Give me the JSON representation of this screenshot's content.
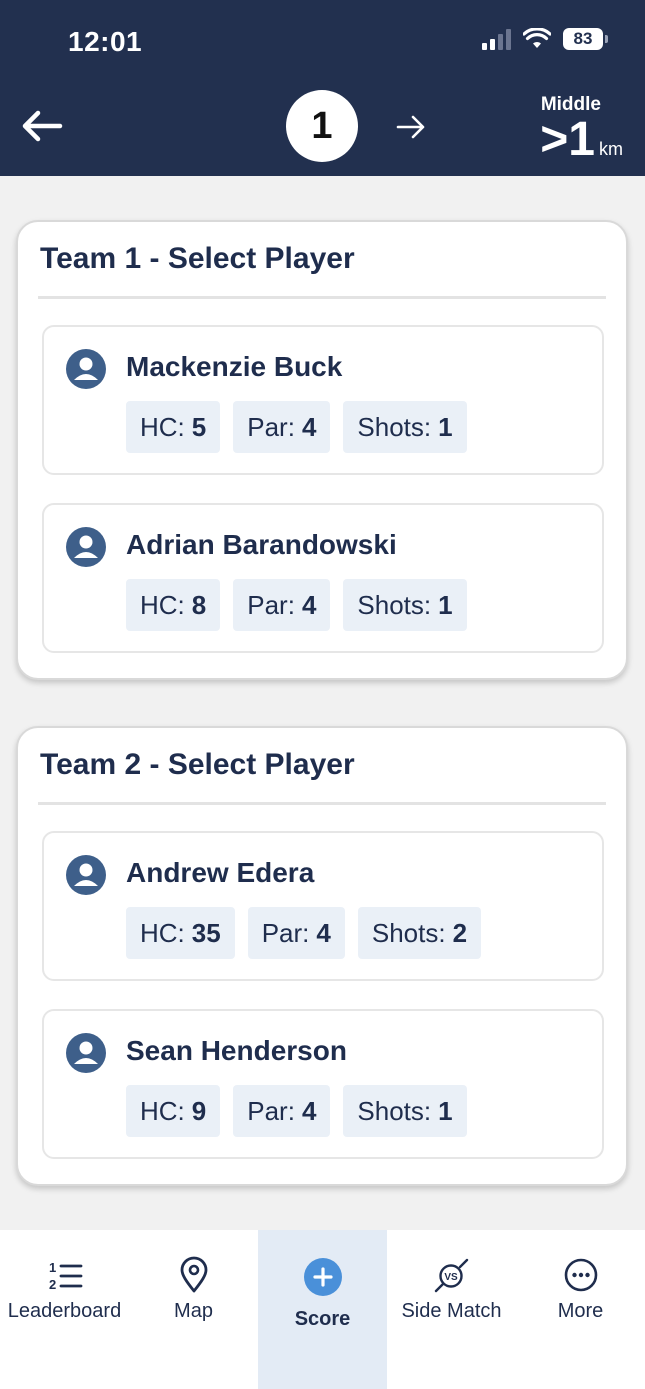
{
  "status_bar": {
    "time": "12:01",
    "battery": "83"
  },
  "header": {
    "hole_number": "1",
    "distance_label": "Middle",
    "distance_value": ">1",
    "distance_unit": "km"
  },
  "teams": [
    {
      "title": "Team 1 - Select Player",
      "players": [
        {
          "name": "Mackenzie Buck",
          "hc": "5",
          "par": "4",
          "shots": "1"
        },
        {
          "name": "Adrian Barandowski",
          "hc": "8",
          "par": "4",
          "shots": "1"
        }
      ]
    },
    {
      "title": "Team 2 - Select Player",
      "players": [
        {
          "name": "Andrew Edera",
          "hc": "35",
          "par": "4",
          "shots": "2"
        },
        {
          "name": "Sean Henderson",
          "hc": "9",
          "par": "4",
          "shots": "1"
        }
      ]
    }
  ],
  "labels": {
    "hc": "HC:",
    "par": "Par:",
    "shots": "Shots:"
  },
  "bottom_nav": [
    {
      "label": "Leaderboard",
      "icon": "leaderboard-icon"
    },
    {
      "label": "Map",
      "icon": "map-pin-icon"
    },
    {
      "label": "Score",
      "icon": "plus-circle-icon",
      "active": true
    },
    {
      "label": "Side Match",
      "icon": "vs-icon"
    },
    {
      "label": "More",
      "icon": "more-icon"
    }
  ],
  "colors": {
    "header_bg": "#22304f",
    "accent": "#4a90d9",
    "avatar": "#3e5f8a",
    "stat_bg": "#eaf0f7",
    "active_nav_bg": "#e3ebf5"
  }
}
